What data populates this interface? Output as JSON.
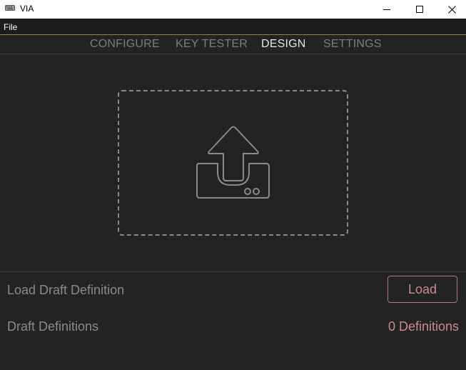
{
  "window": {
    "title": "VIA",
    "app_icon": "keyboard-icon",
    "controls": [
      "minimize-icon",
      "maximize-icon",
      "close-icon"
    ]
  },
  "menu": {
    "file_label": "File"
  },
  "nav": {
    "tabs": [
      {
        "label": "CONFIGURE",
        "active": false
      },
      {
        "label": "KEY TESTER",
        "active": false
      },
      {
        "label": "DESIGN",
        "active": true
      },
      {
        "label": "SETTINGS",
        "active": false
      }
    ]
  },
  "dropzone": {
    "icon": "upload-icon"
  },
  "design": {
    "load_draft_label": "Load Draft Definition",
    "load_button_label": "Load",
    "draft_definitions_label": "Draft Definitions",
    "definitions_count": "0 Definitions"
  },
  "colors": {
    "background": "#232323",
    "accent": "#c98b8b",
    "menu_border": "#9b7b4f",
    "inactive_text": "#7d7d7d",
    "active_text": "#e6e6e6"
  }
}
